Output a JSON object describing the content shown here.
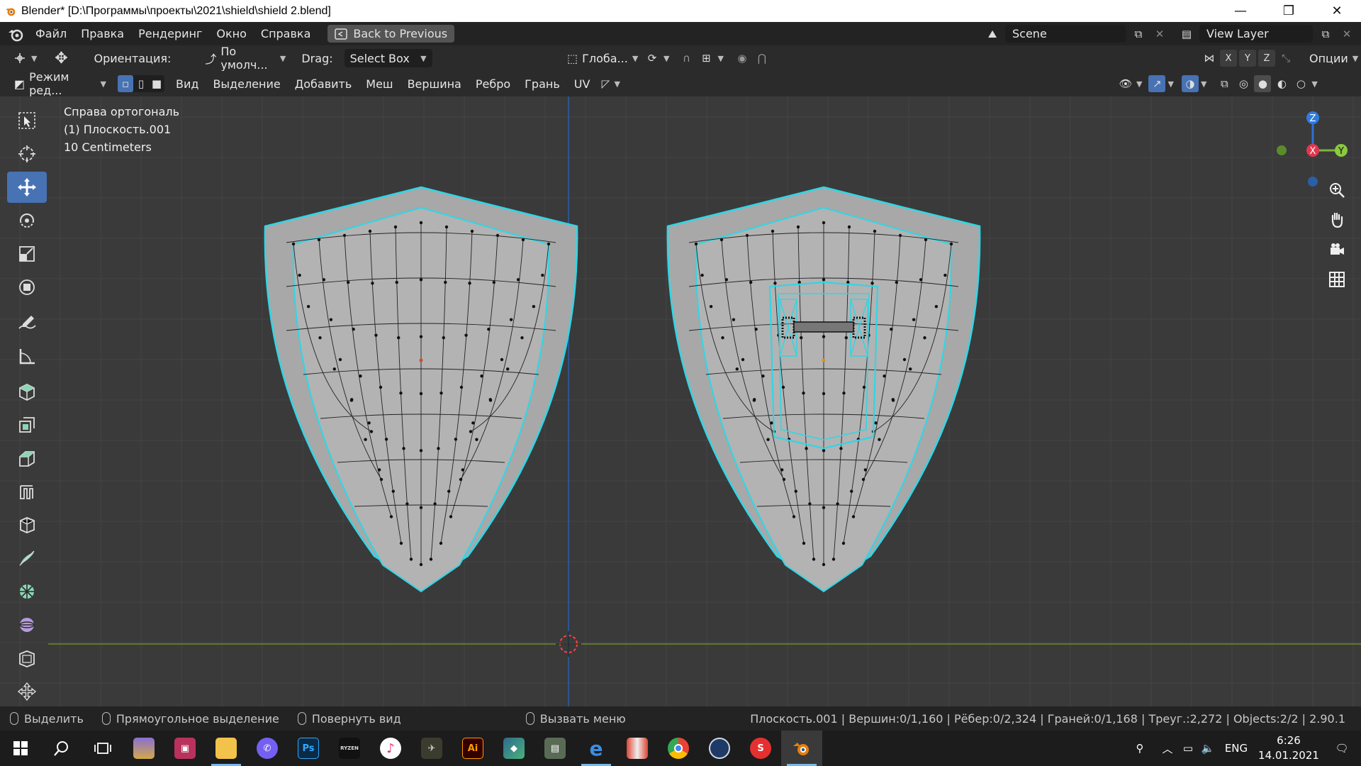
{
  "window": {
    "title": "Blender* [D:\\Программы\\проекты\\2021\\shield\\shield 2.blend]",
    "controls": [
      "minimize-icon",
      "restore-icon",
      "close-icon"
    ]
  },
  "topbar": {
    "menus": [
      "Файл",
      "Правка",
      "Рендеринг",
      "Окно",
      "Справка"
    ],
    "back_button": "Back to Previous",
    "scene_name": "Scene",
    "view_layer": "View Layer"
  },
  "header1": {
    "orientation_label": "Ориентация:",
    "orientation_value": "По умолч...",
    "drag_label": "Drag:",
    "drag_value": "Select Box",
    "transform_orientation": "Глоба...",
    "axis_x": "X",
    "axis_y": "Y",
    "axis_z": "Z",
    "options": "Опции"
  },
  "header2": {
    "mode": "Режим ред...",
    "menus": [
      "Вид",
      "Выделение",
      "Добавить",
      "Меш",
      "Вершина",
      "Ребро",
      "Грань",
      "UV"
    ]
  },
  "viewport": {
    "view_name": "Справа ортогональ",
    "object_name": "(1) Плоскость.001",
    "scale": "10 Centimeters",
    "gizmo": {
      "z": "Z",
      "x": "X",
      "y": "Y"
    },
    "colors": {
      "edge_selected": "#2fd6e6",
      "mesh_face": "#a8a8a8",
      "grid": "#444444",
      "y_axis": "#6c8a2a",
      "z_axis": "#2a5ea8"
    }
  },
  "statusbar": {
    "select": "Выделить",
    "box_select": "Прямоугольное выделение",
    "rotate_view": "Повернуть вид",
    "call_menu": "Вызвать меню",
    "stats": "Плоскость.001 | Вершин:0/1,160 | Рёбер:0/2,324 | Граней:0/1,168 | Треуг.:2,272 | Objects:2/2 | 2.90.1"
  },
  "taskbar": {
    "apps": [
      {
        "name": "winrar",
        "label": ""
      },
      {
        "name": "movie-maker",
        "label": ""
      },
      {
        "name": "file-explorer",
        "label": ""
      },
      {
        "name": "viber",
        "label": ""
      },
      {
        "name": "photoshop",
        "label": "Ps"
      },
      {
        "name": "ryzen-master",
        "label": "RYZEN"
      },
      {
        "name": "itunes",
        "label": ""
      },
      {
        "name": "game",
        "label": ""
      },
      {
        "name": "illustrator",
        "label": "Ai"
      },
      {
        "name": "layers-app",
        "label": ""
      },
      {
        "name": "photo-viewer",
        "label": ""
      },
      {
        "name": "edge",
        "label": ""
      },
      {
        "name": "books-app",
        "label": ""
      },
      {
        "name": "chrome",
        "label": ""
      },
      {
        "name": "cinema4d",
        "label": ""
      },
      {
        "name": "substance",
        "label": ""
      },
      {
        "name": "blender",
        "label": ""
      }
    ],
    "language": "ENG",
    "time": "6:26",
    "date": "14.01.2021"
  }
}
